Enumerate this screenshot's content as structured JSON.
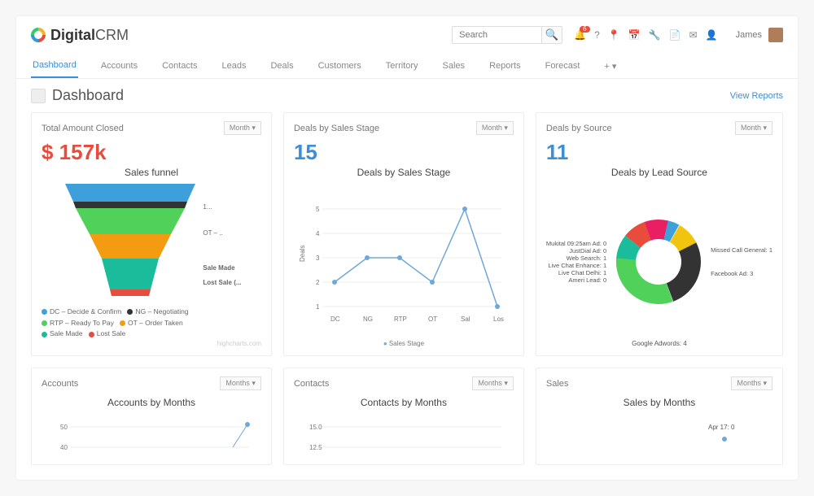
{
  "brand": {
    "name1": "Digital",
    "name2": "CRM"
  },
  "search": {
    "placeholder": "Search"
  },
  "notif_count": "6",
  "user": {
    "name": "James"
  },
  "nav": {
    "items": [
      "Dashboard",
      "Accounts",
      "Contacts",
      "Leads",
      "Deals",
      "Customers",
      "Territory",
      "Sales",
      "Reports",
      "Forecast"
    ],
    "active": 0,
    "more": "+ ▾"
  },
  "page": {
    "title": "Dashboard",
    "right_link": "View Reports"
  },
  "period": "Month ▾",
  "period_plural": "Months ▾",
  "cards": {
    "total_closed": {
      "title": "Total Amount Closed",
      "value": "$ 157k",
      "chart_title": "Sales funnel",
      "footnote": "highcharts.com",
      "side_labels": [
        "1...",
        "OT – ..",
        "Sale Made",
        "Lost Sale (..."
      ],
      "legend": [
        {
          "color": "#3ea0db",
          "label": "DC – Decide & Confirm"
        },
        {
          "color": "#333333",
          "label": "NG – Negotiating"
        },
        {
          "color": "#4fd15a",
          "label": "RTP – Ready To Pay"
        },
        {
          "color": "#f39c12",
          "label": "OT – Order Taken"
        },
        {
          "color": "#1abc9c",
          "label": "Sale Made"
        },
        {
          "color": "#e74c3c",
          "label": "Lost Sale"
        }
      ]
    },
    "by_stage": {
      "title": "Deals by Sales Stage",
      "value": "15",
      "chart_title": "Deals by Sales Stage",
      "series_name": "Sales Stage",
      "ylabel": "Deals"
    },
    "by_source": {
      "title": "Deals by Source",
      "value": "11",
      "chart_title": "Deals by Lead Source",
      "left_labels": [
        "Mukital 09:25am Ad: 0",
        "JustDial Ad: 0",
        "Web Search: 1",
        "Live Chat Enhance: 1",
        "Live Chat Delhi: 1",
        "Ameri Lead: 0"
      ],
      "right_labels": [
        "Missed Call General: 1",
        "Facebook Ad: 3"
      ],
      "bottom_label": "Google Adwords: 4"
    },
    "accounts": {
      "title": "Accounts",
      "chart_title": "Accounts by Months",
      "yticks": [
        "50",
        "40"
      ]
    },
    "contacts": {
      "title": "Contacts",
      "chart_title": "Contacts by Months",
      "yticks": [
        "15.0",
        "12.5"
      ]
    },
    "sales": {
      "title": "Sales",
      "chart_title": "Sales by Months",
      "label": "Apr 17: 0"
    }
  },
  "chart_data": [
    {
      "type": "funnel",
      "title": "Sales funnel",
      "series": [
        {
          "name": "DC – Decide & Confirm",
          "value": 5,
          "color": "#3ea0db"
        },
        {
          "name": "NG – Negotiating",
          "value": 1,
          "color": "#333333"
        },
        {
          "name": "RTP – Ready To Pay",
          "value": 4,
          "color": "#4fd15a"
        },
        {
          "name": "OT – Order Taken",
          "value": 3,
          "color": "#f39c12"
        },
        {
          "name": "Sale Made",
          "value": 1,
          "color": "#1abc9c"
        },
        {
          "name": "Lost Sale",
          "value": 1,
          "color": "#e74c3c"
        }
      ]
    },
    {
      "type": "line",
      "title": "Deals by Sales Stage",
      "xlabel": "",
      "ylabel": "Deals",
      "categories": [
        "DC",
        "NG",
        "RTP",
        "OT",
        "Sal",
        "Los"
      ],
      "series": [
        {
          "name": "Sales Stage",
          "values": [
            2,
            3,
            3,
            2,
            5,
            1
          ]
        }
      ],
      "ylim": [
        0,
        6
      ],
      "yticks": [
        0,
        1,
        2,
        3,
        4,
        5
      ]
    },
    {
      "type": "pie",
      "title": "Deals by Lead Source",
      "series": [
        {
          "name": "Google Adwords",
          "value": 4,
          "color": "#4fd15a"
        },
        {
          "name": "Facebook Ad",
          "value": 3,
          "color": "#333333"
        },
        {
          "name": "Missed Call General",
          "value": 1,
          "color": "#f1c40f"
        },
        {
          "name": "Mukital 09:25am Ad",
          "value": 0,
          "color": "#3ea0db"
        },
        {
          "name": "JustDial Ad",
          "value": 0,
          "color": "#9b59b6"
        },
        {
          "name": "Web Search",
          "value": 1,
          "color": "#e91e63"
        },
        {
          "name": "Live Chat Enhance",
          "value": 1,
          "color": "#e74c3c"
        },
        {
          "name": "Live Chat Delhi",
          "value": 1,
          "color": "#1abc9c"
        },
        {
          "name": "Ameri Lead",
          "value": 0,
          "color": "#95a5a6"
        }
      ]
    },
    {
      "type": "line",
      "title": "Accounts by Months",
      "categories": [
        "…"
      ],
      "series": [
        {
          "name": "Accounts",
          "values": [
            50
          ]
        }
      ],
      "ylim": [
        40,
        50
      ]
    },
    {
      "type": "line",
      "title": "Contacts by Months",
      "categories": [
        "…"
      ],
      "series": [
        {
          "name": "Contacts",
          "values": [
            15
          ]
        }
      ],
      "ylim": [
        12.5,
        15
      ]
    },
    {
      "type": "line",
      "title": "Sales by Months",
      "categories": [
        "Apr 17"
      ],
      "series": [
        {
          "name": "Sales",
          "values": [
            0
          ]
        }
      ]
    }
  ]
}
